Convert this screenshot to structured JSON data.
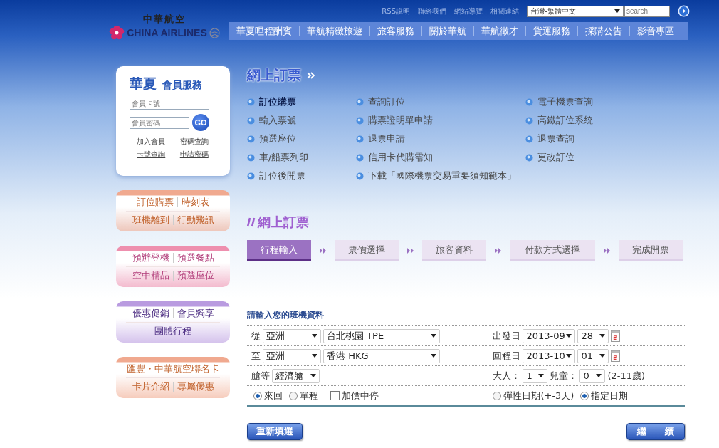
{
  "header": {
    "logo": {
      "chinese": "中華航空",
      "english": "CHINA AIRLINES"
    },
    "top_links": [
      "RSS說明",
      "聯絡我們",
      "網站導覽",
      "相關連結"
    ],
    "language_select": {
      "value": "台灣-繁體中文"
    },
    "search": {
      "placeholder": "search"
    },
    "nav_items": [
      "華夏哩程酬賓",
      "華航精緻旅遊",
      "旅客服務",
      "關於華航",
      "華航徵才",
      "貨運服務",
      "採購公告",
      "影音專區"
    ]
  },
  "member_panel": {
    "title": "華夏",
    "subtitle": "會員服務",
    "card_field": {
      "placeholder": "會員卡號"
    },
    "password_field": {
      "placeholder": "會員密碼"
    },
    "go_button": "GO",
    "links": [
      "加入會員",
      "密碼查詢",
      "卡號查詢",
      "申請密碼"
    ]
  },
  "side_menus": [
    {
      "color": "#f0a98f",
      "rows": [
        [
          "訂位購票",
          "時刻表"
        ],
        [
          "班機離到",
          "行動飛訊"
        ]
      ]
    },
    {
      "color": "#ee8fae",
      "rows": [
        [
          "預辦登機",
          "預選餐點"
        ],
        [
          "空中精品",
          "預選座位"
        ]
      ]
    },
    {
      "color": "#b99be0",
      "rows": [
        [
          "優惠促銷",
          "會員獨享"
        ],
        [
          "團體行程"
        ]
      ]
    },
    {
      "color": "#f0a98f",
      "rows": [
        [
          "匯豐・中華航空聯名卡"
        ],
        [
          "卡片介紹",
          "專屬優惠"
        ]
      ]
    }
  ],
  "online_booking": {
    "title": "網上訂票",
    "columns": [
      [
        {
          "label": "訂位購票",
          "selected": true
        },
        {
          "label": "輸入票號",
          "selected": false
        },
        {
          "label": "預選座位",
          "selected": false
        },
        {
          "label": "車/船票列印",
          "selected": false
        },
        {
          "label": "訂位後開票",
          "selected": false
        }
      ],
      [
        {
          "label": "查詢訂位",
          "selected": false
        },
        {
          "label": "購票證明單申請",
          "selected": false
        },
        {
          "label": "退票申請",
          "selected": false
        },
        {
          "label": "信用卡代購需知",
          "selected": false
        },
        {
          "label": "下載「國際機票交易重要須知範本」",
          "selected": false
        }
      ],
      [
        {
          "label": "電子機票查詢",
          "selected": false
        },
        {
          "label": "高鐵訂位系統",
          "selected": false
        },
        {
          "label": "退票查詢",
          "selected": false
        },
        {
          "label": "更改訂位",
          "selected": false
        }
      ]
    ]
  },
  "booking_form": {
    "title": "網上訂票",
    "steps": [
      {
        "label": "行程輸入",
        "selected": true
      },
      {
        "label": "票價選擇",
        "selected": false
      },
      {
        "label": "旅客資料",
        "selected": false
      },
      {
        "label": "付款方式選擇",
        "selected": false
      },
      {
        "label": "完成開票",
        "selected": false
      }
    ],
    "section_title": "請輸入您的班機資料",
    "from": {
      "label": "從",
      "region": "亞洲",
      "city": "台北桃園 TPE"
    },
    "departure": {
      "label": "出發日",
      "month": "2013-09",
      "day": "28"
    },
    "to": {
      "label": "至",
      "region": "亞洲",
      "city": "香港 HKG"
    },
    "return": {
      "label": "回程日",
      "month": "2013-10",
      "day": "01"
    },
    "cabin": {
      "label": "艙等",
      "value": "經濟艙"
    },
    "adults": {
      "label": "大人：",
      "value": "1"
    },
    "children": {
      "label": "兒童：",
      "value": "0",
      "note": "(2-11歲)"
    },
    "trip_types": [
      {
        "label": "來回",
        "selected": true
      },
      {
        "label": "單程",
        "selected": false
      }
    ],
    "stopover": {
      "label": "加價中停",
      "checked": false
    },
    "date_modes": [
      {
        "label": "彈性日期(+-3天)",
        "selected": false
      },
      {
        "label": "指定日期",
        "selected": true
      }
    ],
    "reset_button": "重新填選",
    "continue_button": "繼　　續"
  }
}
